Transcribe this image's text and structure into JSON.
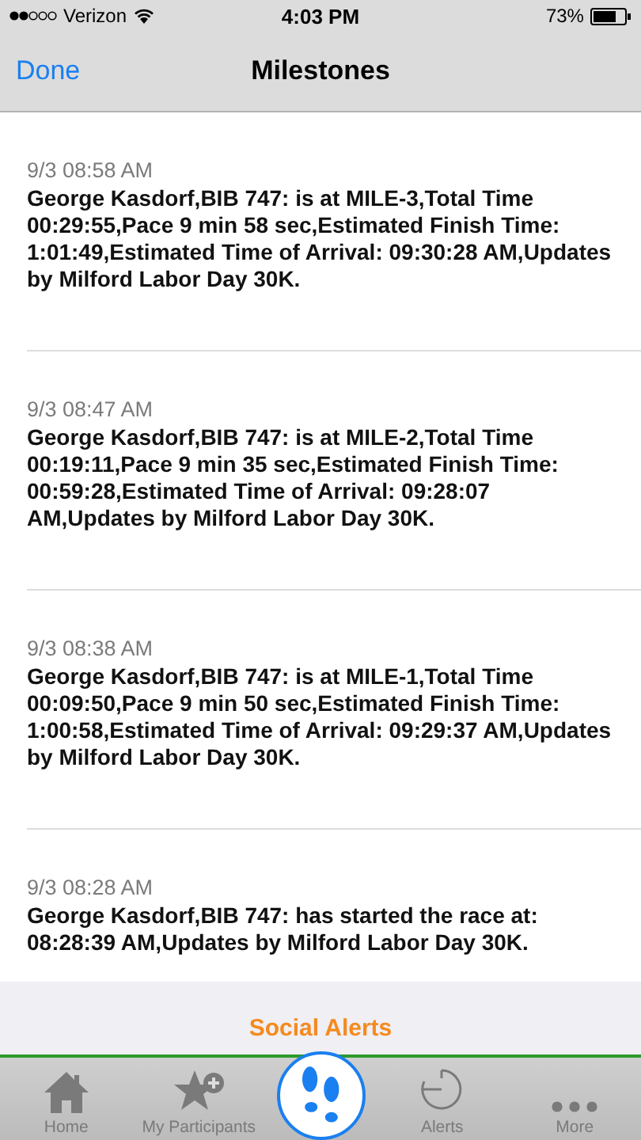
{
  "status_bar": {
    "carrier": "Verizon",
    "time": "4:03 PM",
    "battery": "73%"
  },
  "nav": {
    "back": "Done",
    "title": "Milestones"
  },
  "milestones": [
    {
      "time": "9/3 08:58 AM",
      "text": "George Kasdorf,BIB 747: is at MILE-3,Total Time 00:29:55,Pace 9 min 58 sec,Estimated Finish Time: 1:01:49,Estimated Time of Arrival: 09:30:28 AM,Updates by Milford Labor Day 30K."
    },
    {
      "time": "9/3 08:47 AM",
      "text": "George Kasdorf,BIB 747: is at MILE-2,Total Time 00:19:11,Pace 9 min 35 sec,Estimated Finish Time: 00:59:28,Estimated Time of Arrival: 09:28:07 AM,Updates by Milford Labor Day 30K."
    },
    {
      "time": "9/3 08:38 AM",
      "text": "George Kasdorf,BIB 747: is at MILE-1,Total Time 00:09:50,Pace 9 min 50 sec,Estimated Finish Time: 1:00:58,Estimated Time of Arrival: 09:29:37 AM,Updates by Milford Labor Day 30K."
    },
    {
      "time": "9/3 08:28 AM",
      "text": "George Kasdorf,BIB 747: has started the race at: 08:28:39 AM,Updates by Milford Labor Day 30K."
    }
  ],
  "social_alerts": "Social Alerts",
  "tabs": [
    {
      "kind": "home",
      "label": "Home",
      "selected": false
    },
    {
      "kind": "participants",
      "label": "My Participants",
      "selected": false
    },
    {
      "kind": "footprints",
      "selected": true
    },
    {
      "kind": "alerts",
      "label": "Alerts",
      "selected": false
    },
    {
      "kind": "more",
      "label": "More",
      "selected": false
    }
  ]
}
